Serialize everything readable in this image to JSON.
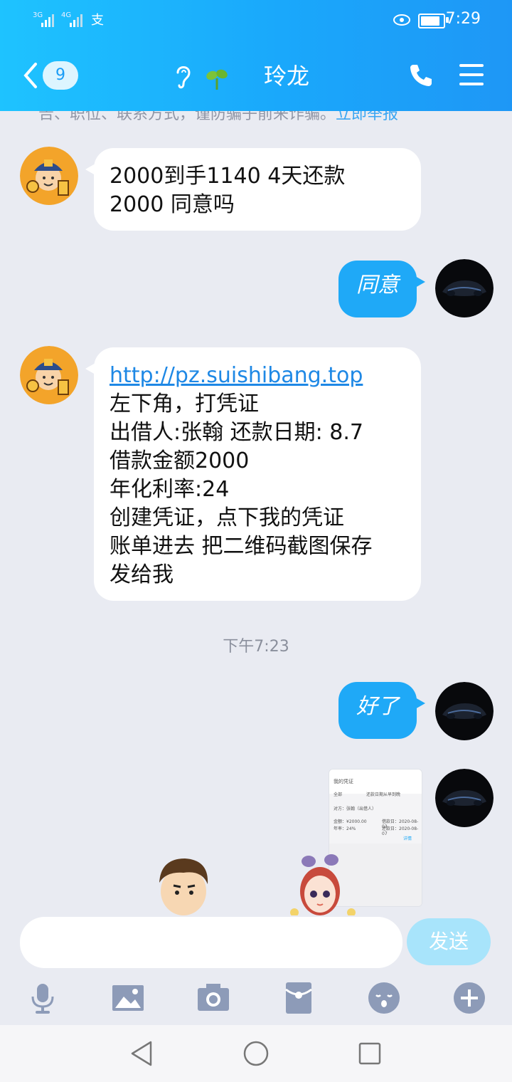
{
  "status": {
    "signal1": "3G",
    "signal2": "4G",
    "time": "7:29"
  },
  "header": {
    "back_count": "9",
    "title": "玲龙"
  },
  "notice": {
    "text": "告、职位、联系方式，谨防骗子前来诈骗。",
    "action": "立即举报"
  },
  "messages": [
    {
      "side": "in",
      "lines": [
        "2000到手1140 4天还款",
        "2000 同意吗"
      ]
    },
    {
      "side": "out",
      "text": "同意"
    },
    {
      "side": "in",
      "link": "http://pz.suishibang.top",
      "lines": [
        "左下角，打凭证",
        "出借人:张翰 还款日期: 8.7",
        "借款金额2000",
        "年化利率:24",
        "创建凭证，点下我的凭证",
        "账单进去 把二维码截图保存",
        "发给我"
      ]
    },
    {
      "side": "out",
      "text": "好了"
    }
  ],
  "timestamp": "下午7:23",
  "thumbnail": {
    "title": "我的凭证",
    "row1": "全部",
    "row2": "还款日期从早到晚",
    "row3": "对方：张翰（出借人）",
    "amount": "金额：¥2000.00",
    "rate": "年率：24%",
    "date1": "借款日：2020-08-03",
    "date2": "还款日：2020-08-07",
    "more": "详情"
  },
  "input": {
    "placeholder": "",
    "send_label": "发送"
  },
  "toolbar": [
    "mic-icon",
    "image-icon",
    "camera-icon",
    "red-packet-icon",
    "emoji-icon",
    "plus-icon"
  ],
  "colors": {
    "header": "#1aa8fb",
    "bubble_out": "#1fa9f7",
    "send": "#a8e4fb",
    "background": "#e9ebf2"
  }
}
